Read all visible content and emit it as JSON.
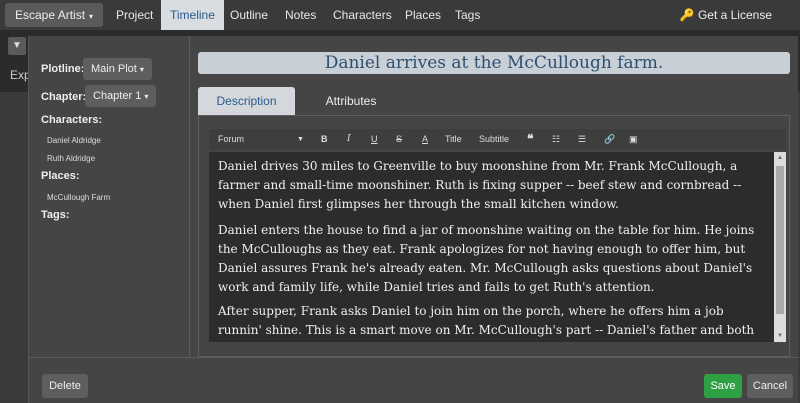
{
  "nav": {
    "brand": "Escape Artist",
    "tabs": [
      "Project",
      "Timeline",
      "Outline",
      "Notes",
      "Characters",
      "Places",
      "Tags"
    ],
    "active_tab": "Timeline",
    "license": "Get a License"
  },
  "background": {
    "exp_label": "Exp"
  },
  "left": {
    "plotline_label": "Plotline:",
    "plotline_value": "Main Plot",
    "chapter_label": "Chapter:",
    "chapter_value": "Chapter 1",
    "characters_label": "Characters:",
    "characters": [
      "Daniel Aldridge",
      "Ruth Aldridge"
    ],
    "places_label": "Places:",
    "places": [
      "McCullough Farm"
    ],
    "tags_label": "Tags:"
  },
  "scene_title": "Daniel arrives at the McCullough farm.",
  "tabs": {
    "description": "Description",
    "attributes": "Attributes"
  },
  "toolbar": {
    "font": "Forum",
    "bold": "B",
    "italic": "I",
    "underline": "U",
    "strike": "S",
    "color": "A",
    "title": "Title",
    "subtitle": "Subtitle"
  },
  "body": {
    "p1": "Daniel drives 30 miles to Greenville to buy moonshine from Mr. Frank McCullough, a farmer and small-time moonshiner. Ruth is fixing supper -- beef stew and cornbread -- when Daniel first glimpses her through the small kitchen window.",
    "p2": "Daniel enters the house to find a jar of moonshine waiting on the table for him. He joins the McCulloughs as they eat. Frank apologizes for not having enough to offer him, but Daniel assures Frank he's already eaten. Mr. McCullough asks questions about Daniel's work and family life, while Daniel tries and fails to get Ruth's attention.",
    "p3": "After supper, Frank asks Daniel to join him on the porch, where he offers him a job runnin' shine. This is a smart move on Mr. McCullough's part -- Daniel's father and both his uncles are cops in Laurens and"
  },
  "buttons": {
    "delete": "Delete",
    "save": "Save",
    "cancel": "Cancel"
  },
  "colors": {
    "save": "#2ea044",
    "active_tab_text": "#2a5b8c"
  }
}
